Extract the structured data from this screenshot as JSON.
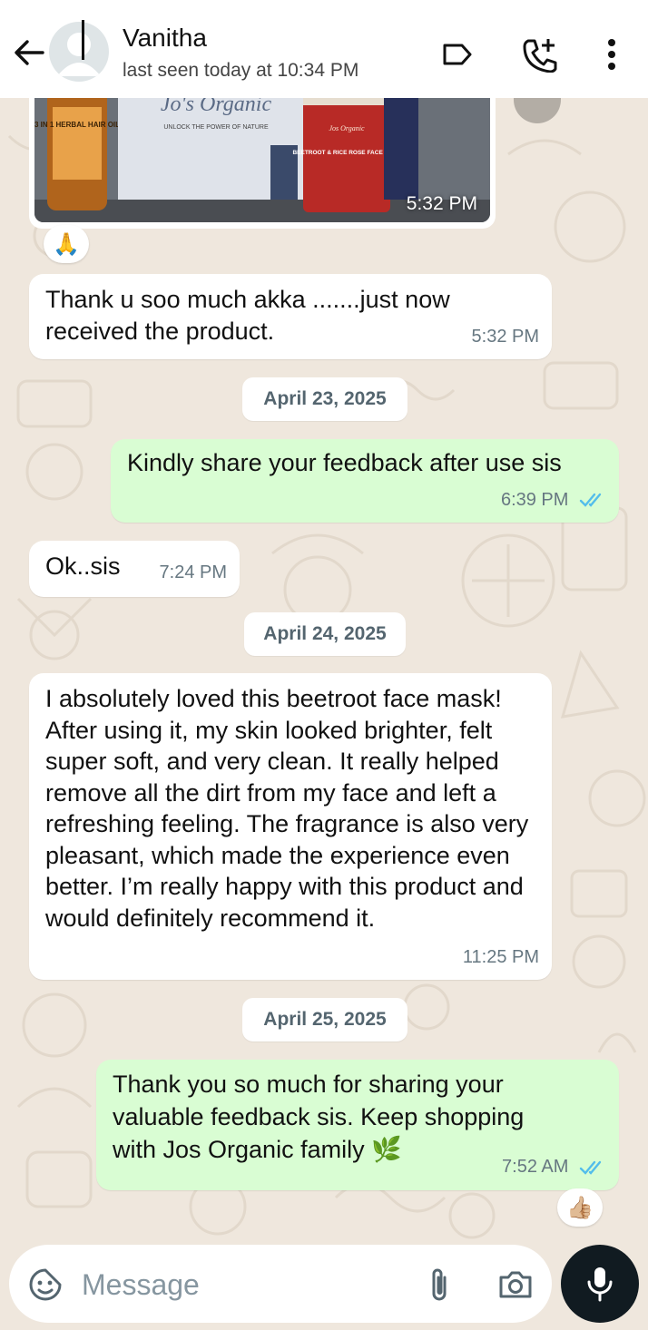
{
  "header": {
    "contact_name": "Vanitha",
    "last_seen": "last seen today at 10:34 PM"
  },
  "image_message": {
    "time": "5:32 PM",
    "reaction": "🙏",
    "photo_texts": {
      "bottle": "3 IN 1 HERBAL HAIR OIL",
      "pack": "Jo's Organic",
      "pack_tagline": "UNLOCK THE POWER OF NATURE",
      "jar_brand": "Jos Organic",
      "jar_label": "BEETROOT & RICE ROSE FACE PACK"
    }
  },
  "messages": [
    {
      "text": "Thank u soo much akka .......just now received the product.",
      "time": "5:32 PM"
    },
    {
      "text": "Kindly share your feedback after use sis",
      "time": "6:39 PM"
    },
    {
      "text": "Ok..sis",
      "time": "7:24 PM"
    },
    {
      "text": "I absolutely loved this beetroot face mask! After using it, my skin looked brighter, felt super soft, and very clean. It really helped remove all the dirt from my face and left a refreshing feeling. The fragrance is also very pleasant, which made the experience even better. I’m really happy with this product and would definitely recommend it.",
      "time": "11:25 PM"
    },
    {
      "text": "Thank you so much for sharing your valuable feedback sis. Keep shopping with Jos Organic family 🌿",
      "time": "7:52 AM",
      "reaction": "👍🏼"
    }
  ],
  "dates": [
    "April 23, 2025",
    "April 24, 2025",
    "April 25, 2025"
  ],
  "composer": {
    "placeholder": "Message"
  },
  "icons": [
    "back-arrow-icon",
    "avatar-placeholder",
    "label-icon",
    "add-call-icon",
    "more-vert-icon",
    "sticker-icon",
    "attach-icon",
    "camera-icon",
    "mic-icon",
    "double-tick-icon"
  ],
  "colors": {
    "outgoing": "#d9fdd3",
    "incoming": "#ffffff",
    "read_ticks": "#53bdeb",
    "background": "#efe7dd"
  }
}
